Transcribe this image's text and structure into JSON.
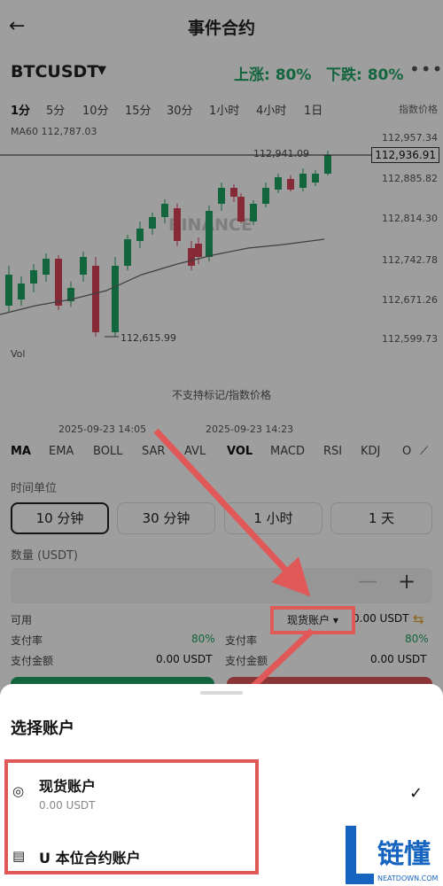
{
  "header": {
    "title": "事件合约"
  },
  "symbol": {
    "name": "BTCUSDT",
    "up_label": "上涨: 80%",
    "down_label": "下跌: 80%"
  },
  "intervals": [
    "1分",
    "5分",
    "10分",
    "15分",
    "30分",
    "1小时",
    "4小时",
    "1日"
  ],
  "index_price_label": "指数价格",
  "chart": {
    "ma60": "MA60 112,787.03",
    "price_ticks": [
      "112,957.34",
      "112,885.82",
      "112,814.30",
      "112,742.78",
      "112,671.26",
      "112,599.73"
    ],
    "current_price": "112,936.91",
    "high_label": "112,941.09",
    "low_label": "112,615.99",
    "watermark": "BINANCE",
    "vol_label": "Vol",
    "notice": "不支持标记/指数价格",
    "time_labels": [
      "2025-09-23 14:05",
      "2025-09-23 14:23"
    ]
  },
  "indicators": [
    "MA",
    "EMA",
    "BOLL",
    "SAR",
    "AVL",
    "VOL",
    "MACD",
    "RSI",
    "KDJ",
    "O"
  ],
  "time_unit": {
    "label": "时间单位",
    "options": [
      "10 分钟",
      "30 分钟",
      "1 小时",
      "1 天"
    ],
    "selected": "10 分钟"
  },
  "quantity": {
    "label": "数量 (USDT)",
    "minus": "—",
    "plus": "+"
  },
  "available": {
    "label": "可用",
    "account": "现货账户",
    "value": "0.00 USDT"
  },
  "left_col": {
    "rate_label": "支付率",
    "rate": "80%",
    "amount_label": "支付金额",
    "amount": "0.00 USDT"
  },
  "right_col": {
    "rate_label": "支付率",
    "rate": "80%",
    "amount_label": "支付金额",
    "amount": "0.00 USDT"
  },
  "sheet": {
    "title": "选择账户",
    "options": [
      {
        "title": "现货账户",
        "subtitle": "0.00 USDT",
        "icon": "spot-account-icon"
      },
      {
        "title": "U 本位合约账户",
        "icon": "futures-account-icon"
      }
    ]
  },
  "watermark": {
    "brand": "链懂",
    "domain": "NEATDOWN.COM"
  },
  "colors": {
    "green": "#1fa463",
    "red": "#e05858",
    "dark": "#222222"
  }
}
